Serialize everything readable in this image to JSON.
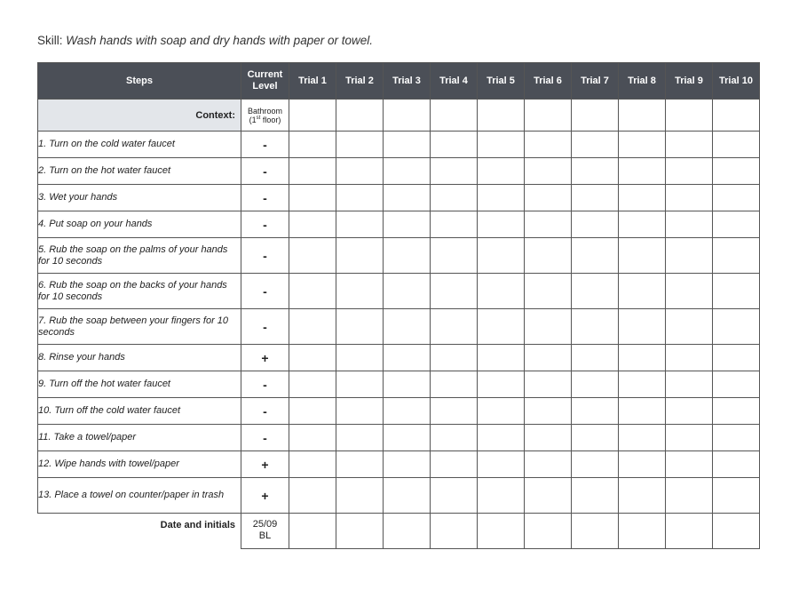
{
  "skill": {
    "label": "Skill:",
    "text": "Wash hands with soap and dry hands with paper or towel."
  },
  "headers": {
    "steps": "Steps",
    "current_level": "Current Level",
    "trials": [
      "Trial 1",
      "Trial 2",
      "Trial 3",
      "Trial 4",
      "Trial 5",
      "Trial 6",
      "Trial 7",
      "Trial 8",
      "Trial 9",
      "Trial 10"
    ]
  },
  "context": {
    "label": "Context:",
    "place": "Bathroom",
    "floor_num": "(1",
    "floor_sup": "st",
    "floor_rest": " floor)"
  },
  "steps": [
    {
      "text": "1. Turn on the cold water faucet",
      "level": "-"
    },
    {
      "text": "2. Turn on the hot water faucet",
      "level": "-"
    },
    {
      "text": "3. Wet your hands",
      "level": "-"
    },
    {
      "text": "4. Put soap on your hands",
      "level": "-"
    },
    {
      "text": "5. Rub the soap on the palms of your hands for 10 seconds",
      "level": "-"
    },
    {
      "text": "6. Rub the soap on the backs of your hands for 10 seconds",
      "level": "-"
    },
    {
      "text": "7. Rub the soap between your fingers for 10 seconds",
      "level": "-"
    },
    {
      "text": "8. Rinse your hands",
      "level": "+"
    },
    {
      "text": "9. Turn off the hot water faucet",
      "level": "-"
    },
    {
      "text": "10. Turn off the cold water faucet",
      "level": "-"
    },
    {
      "text": "11. Take a towel/paper",
      "level": "-"
    },
    {
      "text": "12. Wipe hands with towel/paper",
      "level": "+"
    },
    {
      "text": "13. Place a towel on counter/paper in trash",
      "level": "+"
    }
  ],
  "footer": {
    "label": "Date and initials",
    "date": "25/09",
    "initials": "BL"
  }
}
